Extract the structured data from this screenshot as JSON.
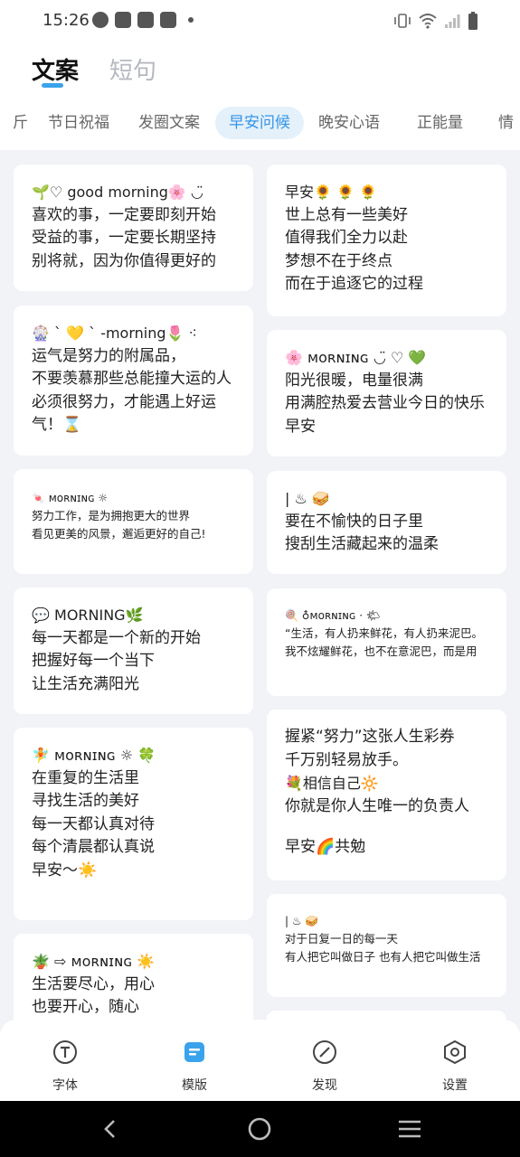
{
  "status_bar": {
    "time": "15:26"
  },
  "header": {
    "tab_active": "文案",
    "tab_inactive": "短句"
  },
  "categories": [
    "斤",
    "节日祝福",
    "发圈文案",
    "早安问候",
    "晚安心语",
    "正能量",
    "情"
  ],
  "active_category": "早安问候",
  "cards_left": [
    {
      "size": "large",
      "lines": [
        "🌱♡ good morning🌸 ◡̈",
        "喜欢的事，一定要即刻开始",
        "受益的事，一定要长期坚持",
        "别将就，因为你值得更好的"
      ]
    },
    {
      "size": "large",
      "lines": [
        "🎡 ` 💛 ` -morning🌷 ⁖",
        "运气是努力的附属品，",
        "不要羡慕那些总能撞大运的人",
        "必须很努力，才能遇上好运",
        "气！⌛"
      ]
    },
    {
      "size": "small",
      "lines": [
        "🍬 ᴍᴏʀɴɪɴɢ ☼",
        "努力工作，是为拥抱更大的世界",
        "看见更美的风景，邂逅更好的自己!"
      ]
    },
    {
      "size": "large",
      "lines": [
        "💬  MORNING🌿",
        "每一天都是一个新的开始",
        "把握好每一个当下",
        "让生活充满阳光"
      ]
    },
    {
      "size": "large",
      "lines": [
        "🧚 ᴍᴏʀɴɪɴɢ ☼ 🍀",
        "在重复的生活里",
        "寻找生活的美好",
        "每一天都认真对待",
        "每个清晨都认真说",
        "早安～☀️"
      ]
    },
    {
      "size": "large",
      "lines": [
        "🪴 ⇨ ᴍᴏʀɴɪɴɢ  ☀️",
        "生活要尽心，用心",
        "也要开心，随心"
      ]
    }
  ],
  "cards_right": [
    {
      "size": "large",
      "lines": [
        "早安🌻 🌻 🌻",
        "世上总有一些美好",
        "值得我们全力以赴",
        "梦想不在于终点",
        "而在于追逐它的过程"
      ]
    },
    {
      "size": "large",
      "lines": [
        "🌸 ᴍᴏʀɴɪɴɢ ◡̈ ♡ 💚",
        "阳光很暖，电量很满",
        "用满腔热爱去营业今日的快乐",
        "早安"
      ]
    },
    {
      "size": "large",
      "lines": [
        "| ♨ 🥪",
        "要在不愉快的日子里",
        "搜刮生活藏起来的温柔"
      ]
    },
    {
      "size": "small",
      "lines": [
        "🍭 ♁ᴍᴏʀɴɪɴɢ · 🌤",
        "“生活，有人扔来鲜花，有人扔来泥巴。",
        "我不炫耀鲜花，也不在意泥巴，而是用"
      ]
    },
    {
      "size": "large",
      "lines": [
        "握紧“努力”这张人生彩券",
        "千万别轻易放手。",
        "💐相信自己🔆",
        "你就是你人生唯一的负责人",
        "",
        "早安🌈共勉"
      ]
    },
    {
      "size": "small",
      "lines": [
        "| ♨ 🥪",
        "对于日复一日的每一天",
        "有人把它叫做日子 也有人把它叫做生活"
      ]
    }
  ],
  "bottom_nav": [
    {
      "label": "字体",
      "icon": "font-t-icon"
    },
    {
      "label": "模版",
      "icon": "template-icon"
    },
    {
      "label": "发现",
      "icon": "compass-icon"
    },
    {
      "label": "设置",
      "icon": "settings-hexagon-icon"
    }
  ],
  "colors": {
    "accent": "#3aa3ec",
    "active_chip_bg": "#e4f1fb",
    "background": "#f2f3f7"
  }
}
